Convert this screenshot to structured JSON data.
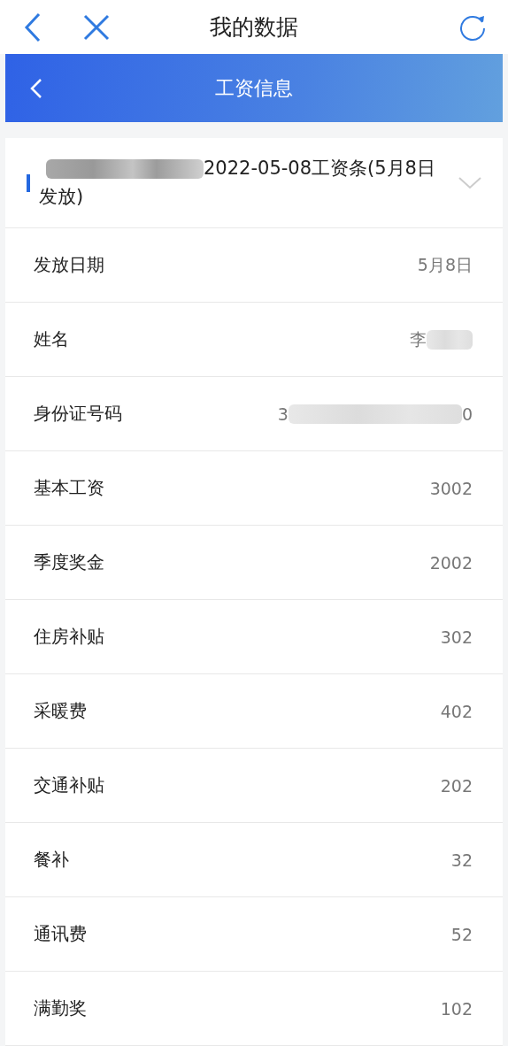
{
  "top_bar": {
    "title": "我的数据"
  },
  "banner": {
    "title": "工资信息"
  },
  "payslip": {
    "title_segments": [
      {
        "kind": "redaction"
      },
      {
        "kind": "text",
        "text": "2022-05-08工资条(5月8日发放)"
      }
    ],
    "expanded": false
  },
  "rows": [
    {
      "label": "发放日期",
      "segments": [
        {
          "kind": "text",
          "text": "5月8日"
        }
      ]
    },
    {
      "label": "姓名",
      "segments": [
        {
          "kind": "text",
          "text": "李"
        },
        {
          "kind": "redaction"
        }
      ]
    },
    {
      "label": "身份证号码",
      "segments": [
        {
          "kind": "text",
          "text": "3"
        },
        {
          "kind": "redaction"
        },
        {
          "kind": "text",
          "text": "0"
        }
      ]
    },
    {
      "label": "基本工资",
      "segments": [
        {
          "kind": "text",
          "text": "3002"
        }
      ]
    },
    {
      "label": "季度奖金",
      "segments": [
        {
          "kind": "text",
          "text": "2002"
        }
      ]
    },
    {
      "label": "住房补贴",
      "segments": [
        {
          "kind": "text",
          "text": "302"
        }
      ]
    },
    {
      "label": "采暖费",
      "segments": [
        {
          "kind": "text",
          "text": "402"
        }
      ]
    },
    {
      "label": "交通补贴",
      "segments": [
        {
          "kind": "text",
          "text": "202"
        }
      ]
    },
    {
      "label": "餐补",
      "segments": [
        {
          "kind": "text",
          "text": "32"
        }
      ]
    },
    {
      "label": "通讯费",
      "segments": [
        {
          "kind": "text",
          "text": "52"
        }
      ]
    },
    {
      "label": "满勤奖",
      "segments": [
        {
          "kind": "text",
          "text": "102"
        }
      ]
    }
  ]
}
